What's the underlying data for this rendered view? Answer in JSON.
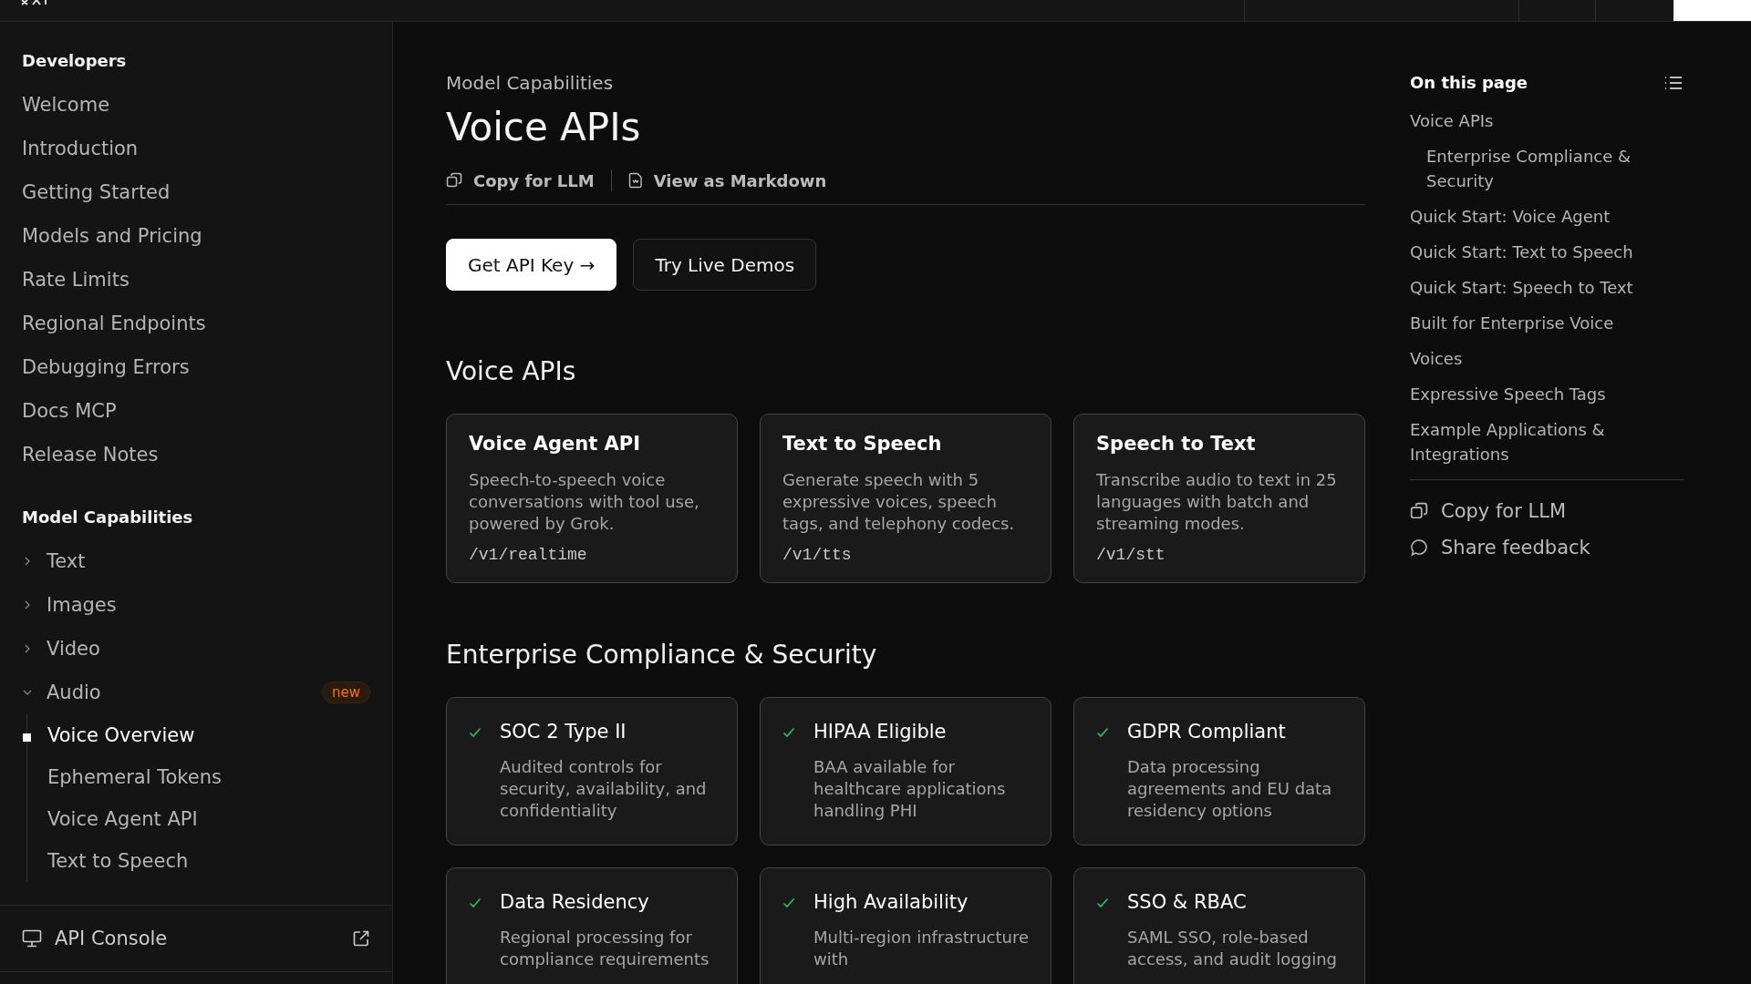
{
  "sidebar": {
    "sections": [
      {
        "title": "Developers",
        "items": [
          {
            "label": "Welcome",
            "selected": false
          },
          {
            "label": "Introduction",
            "selected": false
          },
          {
            "label": "Getting Started",
            "selected": false
          },
          {
            "label": "Models and Pricing",
            "selected": false
          },
          {
            "label": "Rate Limits",
            "selected": false
          },
          {
            "label": "Regional Endpoints",
            "selected": false
          },
          {
            "label": "Debugging Errors",
            "selected": false
          },
          {
            "label": "Docs MCP",
            "selected": false
          },
          {
            "label": "Release Notes",
            "selected": false
          }
        ]
      },
      {
        "title": "Model Capabilities",
        "items": [
          {
            "label": "Text",
            "expanded": false
          },
          {
            "label": "Images",
            "expanded": false
          },
          {
            "label": "Video",
            "expanded": false
          },
          {
            "label": "Audio",
            "expanded": true,
            "badge": "new",
            "children": [
              {
                "label": "Voice Overview",
                "selected": true
              },
              {
                "label": "Ephemeral Tokens",
                "selected": false
              },
              {
                "label": "Voice Agent API",
                "selected": false
              },
              {
                "label": "Text to Speech",
                "selected": false
              }
            ]
          }
        ]
      }
    ],
    "footer": {
      "label": "API Console"
    }
  },
  "main": {
    "breadcrumb": "Model Capabilities",
    "title": "Voice APIs",
    "actions": [
      {
        "kind": "copy",
        "label": "Copy for LLM"
      },
      {
        "kind": "markdown",
        "label": "View as Markdown"
      }
    ],
    "buttons": [
      {
        "label": "Get API Key →",
        "primary": true
      },
      {
        "label": "Try Live Demos",
        "primary": false
      }
    ],
    "sections": [
      {
        "heading": "Voice APIs",
        "kind": "api",
        "cards": [
          {
            "title": "Voice Agent API",
            "text": "Speech-to-speech voice conversations with tool use, powered by Grok.",
            "endpoint": "/v1/realtime"
          },
          {
            "title": "Text to Speech",
            "text": "Generate speech with 5 expressive voices, speech tags, and telephony codecs.",
            "endpoint": "/v1/tts"
          },
          {
            "title": "Speech to Text",
            "text": "Transcribe audio to text in 25 languages with batch and streaming modes.",
            "endpoint": "/v1/stt"
          }
        ]
      },
      {
        "heading": "Enterprise Compliance & Security",
        "kind": "check",
        "cards": [
          {
            "title": "SOC 2 Type II",
            "text": "Audited controls for security, availability, and confidentiality"
          },
          {
            "title": "HIPAA Eligible",
            "text": "BAA available for healthcare applications handling PHI"
          },
          {
            "title": "GDPR Compliant",
            "text": "Data processing agreements and EU data residency options"
          },
          {
            "title": "Data Residency",
            "text": "Regional processing for compliance requirements"
          },
          {
            "title": "High Availability",
            "text": "Multi-region infrastructure with"
          },
          {
            "title": "SSO & RBAC",
            "text": "SAML SSO, role-based access, and audit logging"
          }
        ]
      }
    ]
  },
  "toc": {
    "title": "On this page",
    "items": [
      {
        "label": "Voice APIs",
        "children": [
          {
            "label": "Enterprise Compliance & Security"
          }
        ]
      },
      {
        "label": "Quick Start: Voice Agent"
      },
      {
        "label": "Quick Start: Text to Speech"
      },
      {
        "label": "Quick Start: Speech to Text"
      },
      {
        "label": "Built for Enterprise Voice"
      },
      {
        "label": "Voices"
      },
      {
        "label": "Expressive Speech Tags"
      },
      {
        "label": "Example Applications & Integrations"
      }
    ],
    "actions": [
      {
        "kind": "copy",
        "label": "Copy for LLM"
      },
      {
        "kind": "feedback",
        "label": "Share feedback"
      }
    ]
  }
}
